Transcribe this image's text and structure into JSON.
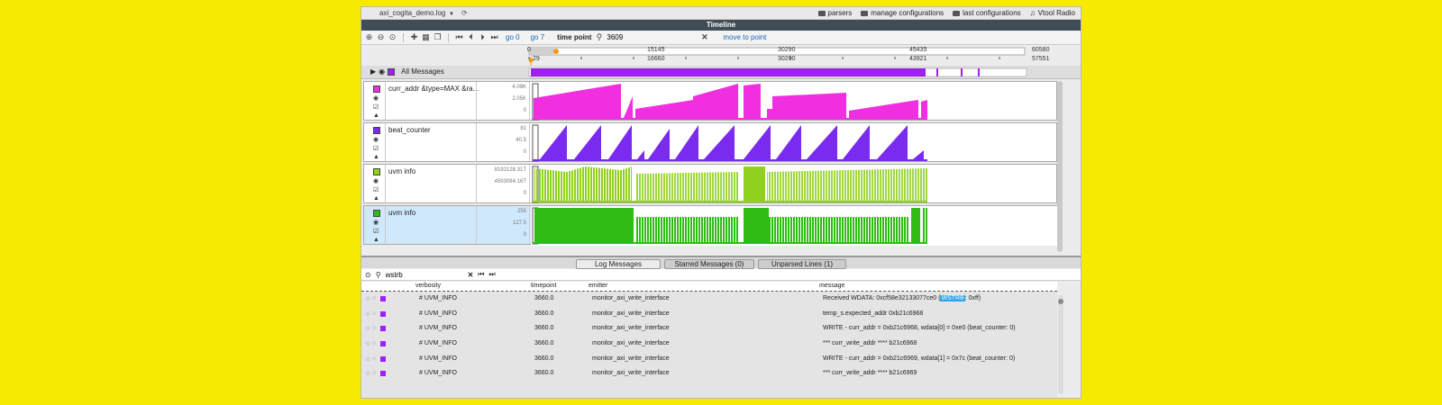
{
  "appbar": {
    "file_name": "axi_cogita_demo.log",
    "menu": [
      "parsers",
      "manage configurations",
      "last configurations",
      "Vtool Radio"
    ]
  },
  "panel_title": "Timeline",
  "toolbar": {
    "go_start": "go 0",
    "go_end": "go 7",
    "time_point_label": "time point",
    "time_point_value": "3609",
    "move_to_point": "move to point"
  },
  "ruler": {
    "top_ticks": [
      "0",
      "15145",
      "30290",
      "45435",
      "60580"
    ],
    "bottom_ticks": [
      "29",
      "16660",
      "30290",
      "43921",
      "57551"
    ]
  },
  "all_messages": {
    "label": "All Messages",
    "color": "#a020f0"
  },
  "tracks": [
    {
      "name": "curr_addr &type=MAX &ra...",
      "color": "#ef2fe0",
      "vals": [
        "4.09K",
        "2.05K",
        "0"
      ]
    },
    {
      "name": "beat_counter",
      "color": "#7b2bf0",
      "vals": [
        "81",
        "40.5",
        "0"
      ]
    },
    {
      "name": "uvm info",
      "color": "#8fd11c",
      "vals": [
        "8192128.31T",
        "4593084.16T",
        "0"
      ]
    },
    {
      "name": "uvm info",
      "color": "#2fbd13",
      "vals": [
        "255",
        "127.5",
        "0"
      ]
    }
  ],
  "tabs": [
    "Log Messages",
    "Starred Messages (0)",
    "Unparsed Lines (1)"
  ],
  "filter": {
    "value": "wstrb"
  },
  "columns": [
    "verbosity",
    "timepoint",
    "emitter",
    "message"
  ],
  "rows": [
    {
      "verbosity": "# UVM_INFO",
      "timepoint": "3660.0",
      "emitter": "monitor_axi_write_interface",
      "msg_pre": "Received WDATA: 0xcf58e32133077ce0 (",
      "msg_hl": "WSTRB",
      "msg_post": ": 0xff)"
    },
    {
      "verbosity": "# UVM_INFO",
      "timepoint": "3660.0",
      "emitter": "monitor_axi_write_interface",
      "msg_pre": "temp_s.expected_addr 0xb21c6968",
      "msg_hl": "",
      "msg_post": ""
    },
    {
      "verbosity": "# UVM_INFO",
      "timepoint": "3660.0",
      "emitter": "monitor_axi_write_interface",
      "msg_pre": "WRITE - curr_addr = 0xb21c6968, wdata[0] = 0xe0 (beat_counter: 0)",
      "msg_hl": "",
      "msg_post": ""
    },
    {
      "verbosity": "# UVM_INFO",
      "timepoint": "3660.0",
      "emitter": "monitor_axi_write_interface",
      "msg_pre": "*** curr_write_addr **** b21c6968",
      "msg_hl": "",
      "msg_post": ""
    },
    {
      "verbosity": "# UVM_INFO",
      "timepoint": "3660.0",
      "emitter": "monitor_axi_write_interface",
      "msg_pre": "WRITE - curr_addr = 0xb21c6969, wdata[1] = 0x7c (beat_counter: 0)",
      "msg_hl": "",
      "msg_post": ""
    },
    {
      "verbosity": "# UVM_INFO",
      "timepoint": "3660.0",
      "emitter": "monitor_axi_write_interface",
      "msg_pre": "*** curr_write_addr **** b21c6969",
      "msg_hl": "",
      "msg_post": ""
    }
  ]
}
